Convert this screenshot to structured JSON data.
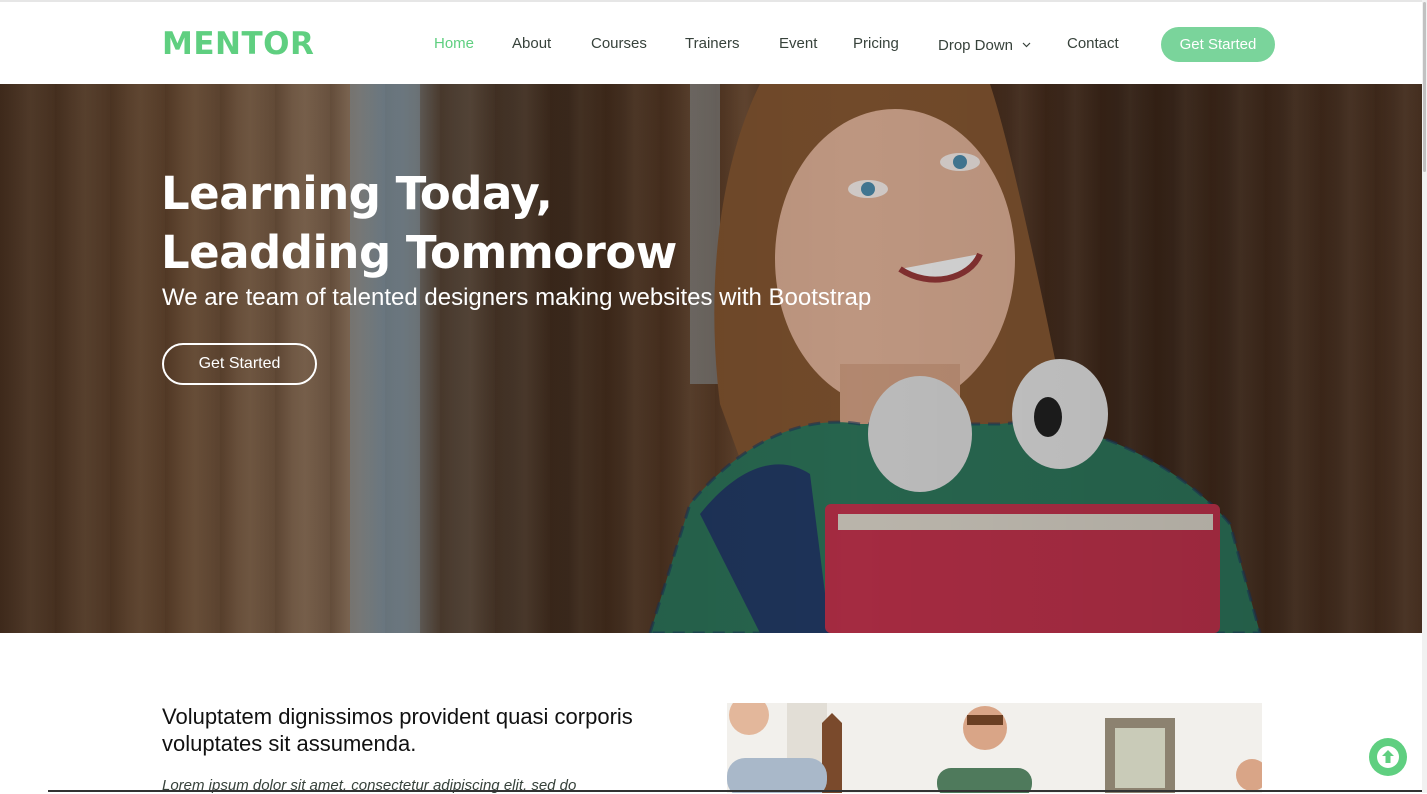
{
  "brand": {
    "logo": "MENTOR",
    "accent_color": "#5fcf80"
  },
  "nav": {
    "items": [
      {
        "label": "Home",
        "active": true
      },
      {
        "label": "About"
      },
      {
        "label": "Courses"
      },
      {
        "label": "Trainers"
      },
      {
        "label": "Event"
      },
      {
        "label": "Pricing"
      },
      {
        "label": "Drop Down",
        "icon": "chevron-down-icon"
      },
      {
        "label": "Contact"
      }
    ],
    "cta_label": "Get Started"
  },
  "hero": {
    "title_line1": "Learning Today,",
    "title_line2": "Leadding Tommorow",
    "subtitle": "We are team of talented designers making websites with Bootstrap",
    "button_label": "Get Started"
  },
  "about": {
    "heading": "Voluptatem dignissimos provident quasi corporis voluptates sit assumenda.",
    "text": "Lorem ipsum dolor sit amet, consectetur adipiscing elit, sed do"
  },
  "back_to_top": {
    "icon": "arrow-up-icon"
  }
}
